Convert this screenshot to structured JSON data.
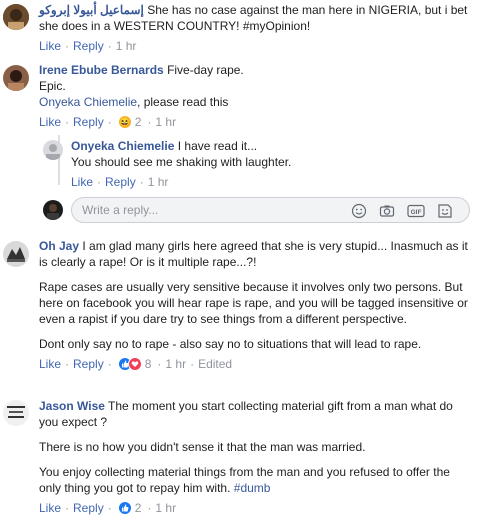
{
  "comments": [
    {
      "author": "إسماعيل أبيولا إبروكو",
      "text": "She has no case against the man here in NIGERIA, but i bet she does in a WESTERN COUNTRY! #myOpinion!",
      "like": "Like",
      "reply": "Reply",
      "time": "1 hr"
    },
    {
      "author": "Irene Ebube Bernards",
      "text": "Five-day rape.",
      "line2": "Epic.",
      "mention": "Onyeka Chiemelie",
      "line3": ", please read this",
      "like": "Like",
      "reply": "Reply",
      "reaction_count": "2",
      "time": "1 hr"
    },
    {
      "author": "Onyeka Chiemelie",
      "text": "I have read it...",
      "line2": "You should see me shaking with laughter.",
      "like": "Like",
      "reply": "Reply",
      "time": "1 hr"
    },
    {
      "author": "Oh Jay",
      "text": "I am glad many girls here agreed that she is very stupid... Inasmuch as it is clearly a rape! Or is it multiple rape...?!",
      "para2": "Rape cases are usually very sensitive because it involves only two persons. But here on facebook you will hear rape is rape, and you will be tagged insensitive or even a rapist if you dare try to see things from a different perspective.",
      "para3": "Dont only say no to rape - also say no to situations that will lead to rape.",
      "like": "Like",
      "reply": "Reply",
      "reaction_count": "8",
      "time": "1 hr",
      "edited": "Edited"
    },
    {
      "author": "Jason Wise",
      "text": "The moment you start collecting material gift from a man what do you expect ?",
      "para2": "There is no how you didn't sense it that the man was married.",
      "para3": "You enjoy collecting material things from the man and you refused to offer the only thing you got to repay him with.",
      "hashtag": "#dumb",
      "like": "Like",
      "reply": "Reply",
      "reaction_count": "2",
      "time": "1 hr"
    }
  ],
  "reply_box": {
    "placeholder": "Write a reply..."
  },
  "icons": {
    "emoji": "smiley-icon",
    "camera": "camera-icon",
    "gif": "gif-icon",
    "sticker": "sticker-icon"
  },
  "colors": {
    "link": "#385898",
    "action": "#4267b2",
    "muted": "#90949c",
    "like_blue": "#1877f2",
    "love_red": "#f33e58",
    "haha_yellow": "#f7b125"
  }
}
